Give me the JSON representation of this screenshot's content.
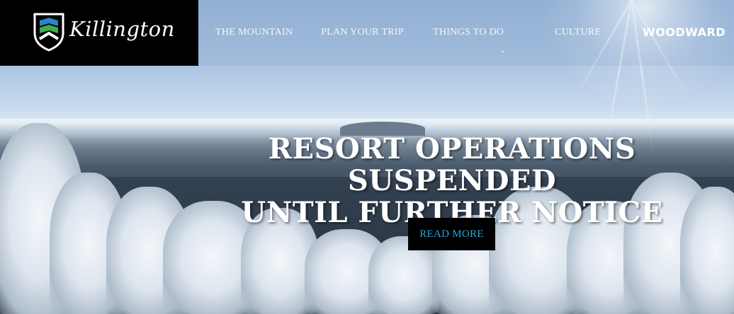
{
  "brand": {
    "name": "Killington"
  },
  "nav": {
    "items": [
      {
        "label": "THE MOUNTAIN"
      },
      {
        "label": "PLAN YOUR TRIP"
      },
      {
        "label": "THINGS TO DO"
      },
      {
        "label": "CULTURE"
      }
    ],
    "woodward": "WOODWARD"
  },
  "hero": {
    "headline_line1": "RESORT OPERATIONS SUSPENDED",
    "headline_line2": "UNTIL FURTHER NOTICE",
    "cta_label": "READ MORE"
  },
  "colors": {
    "header_black": "#000000",
    "cta_text": "#2aa3d9",
    "logo_green": "#3fae49",
    "logo_blue": "#2a86c8"
  }
}
